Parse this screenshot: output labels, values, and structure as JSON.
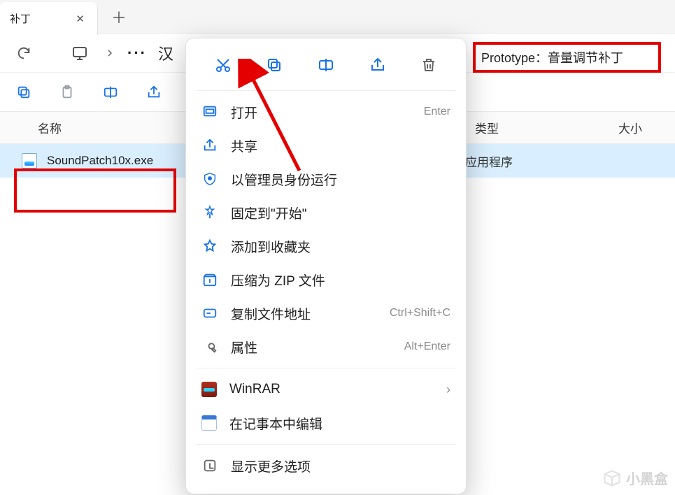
{
  "tab": {
    "title": "补丁"
  },
  "toolbar": {
    "path_fragment": "汉"
  },
  "search": {
    "text": "Prototype：音量调节补丁"
  },
  "columns": {
    "name": "名称",
    "type": "类型",
    "size": "大小"
  },
  "file": {
    "name": "SoundPatch10x.exe",
    "type": "应用程序"
  },
  "ctx": {
    "open": {
      "label": "打开",
      "shortcut": "Enter"
    },
    "share": {
      "label": "共享"
    },
    "admin": {
      "label": "以管理员身份运行"
    },
    "pin_start": {
      "label": "固定到\"开始\""
    },
    "fav": {
      "label": "添加到收藏夹"
    },
    "zip": {
      "label": "压缩为 ZIP 文件"
    },
    "copy_path": {
      "label": "复制文件地址",
      "shortcut": "Ctrl+Shift+C"
    },
    "props": {
      "label": "属性",
      "shortcut": "Alt+Enter"
    },
    "winrar": {
      "label": "WinRAR"
    },
    "notepad": {
      "label": "在记事本中编辑"
    },
    "more": {
      "label": "显示更多选项"
    }
  },
  "watermark": "小黑盒"
}
